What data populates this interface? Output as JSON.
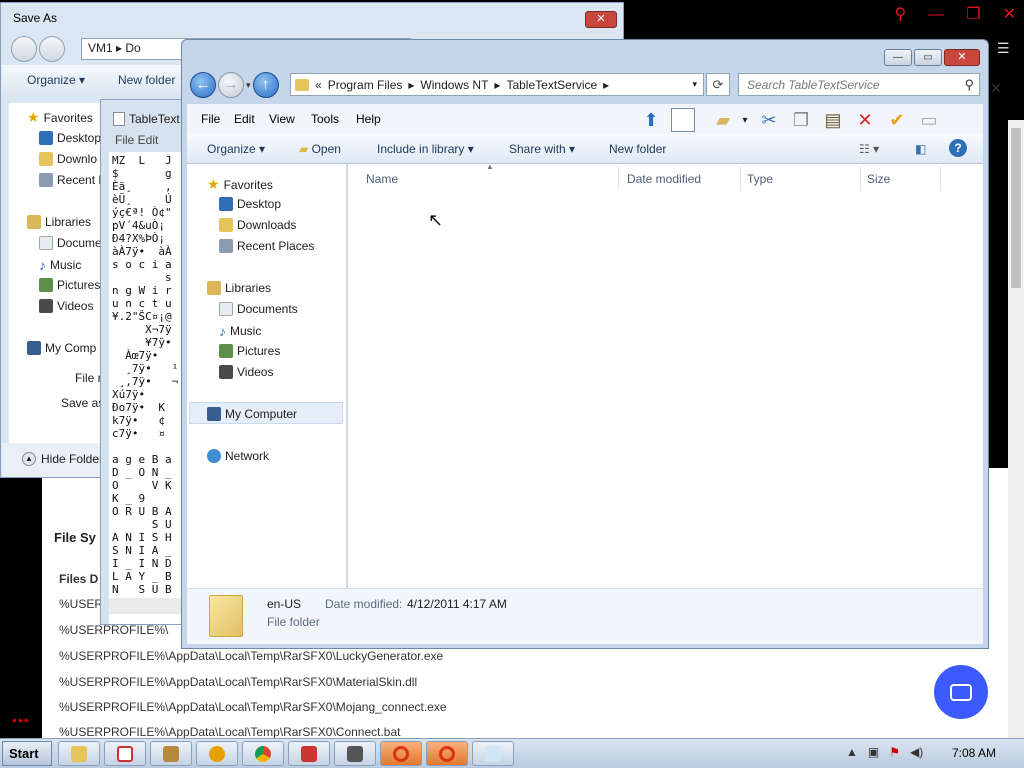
{
  "background": {
    "page_lines": [
      "%USERPROFILE%\\AppData\\Local\\Temp\\RarSFX0\\LuckyGenerator.exe",
      "%USERPROFILE%\\AppData\\Local\\Temp\\RarSFX0\\MaterialSkin.dll",
      "%USERPROFILE%\\AppData\\Local\\Temp\\RarSFX0\\Mojang_connect.exe",
      "%USERPROFILE%\\AppData\\Local\\Temp\\RarSFX0\\Connect.bat"
    ],
    "truncated_line_1": "%USERPROFILE%\\Ap",
    "truncated_line_2": "%USERPROFILE%\\",
    "section_title": "File Sy",
    "sub_title": "Files D",
    "chat_color": "#3d5afe"
  },
  "save_as": {
    "title": "Save As",
    "close": "✕",
    "address": "VM1  ▸  Do",
    "organize": "Organize ▾",
    "new_folder": "New folder",
    "nav": {
      "favorites": "Favorites",
      "desktop": "Desktop",
      "downloads": "Downlo",
      "recent": "Recent P",
      "libraries": "Libraries",
      "documents": "Docume",
      "music": "Music",
      "pictures": "Pictures",
      "videos": "Videos",
      "computer": "My Comp"
    },
    "file_name": "File n",
    "save_as_type": "Save as",
    "hide_folders": "Hide Folders"
  },
  "notepad": {
    "title": "TableText",
    "menu": "File   Edit",
    "content": "MZ  L   J\n$       g\nÈä¸     ,\nèÜ¸     Ú\nýç€ª! Ò¢\"\npV´4&uÒ¡\nÐ4?X%ÞÒ¡\nàÀ7ÿ•  àÀ\ns o c i a\n        s\nn g W i r\nu n c t u\n¥.2\"ŠC¤¡@\n     X¬7ÿ\n     ¥7ÿ•\n  Àœ7ÿ•\n  ¸7ÿ•   ¹\n ¸,7ÿ•   ¬\nXú7ÿ•\nÐo7ÿ•  K\nk7ÿ•   ¢\nc7ÿ•   ¤\n\na g e B a\nD _ O N _\nO     V K\nK _ 9\nO R U B A\n      S U\nA N I S H\nS N I A _\nI _ I N D\nL A Y _ B\nN   S U B"
  },
  "explorer": {
    "breadcrumb": [
      "«",
      "Program Files",
      "Windows NT",
      "TableTextService"
    ],
    "search_placeholder": "Search TableTextService",
    "menu": {
      "file": "File",
      "edit": "Edit",
      "view": "View",
      "tools": "Tools",
      "help": "Help"
    },
    "cmd": {
      "organize": "Organize",
      "open": "Open",
      "include": "Include in library",
      "share": "Share with",
      "new_folder": "New folder"
    },
    "nav": {
      "favorites": "Favorites",
      "desktop": "Desktop",
      "downloads": "Downloads",
      "recent": "Recent Places",
      "libraries": "Libraries",
      "documents": "Documents",
      "music": "Music",
      "pictures": "Pictures",
      "videos": "Videos",
      "computer": "My Computer",
      "network": "Network"
    },
    "columns": {
      "name": "Name",
      "date": "Date modified",
      "type": "Type",
      "size": "Size"
    },
    "details": {
      "name": "en-US",
      "date_label": "Date modified:",
      "date_value": "4/12/2011 4:17 AM",
      "kind": "File folder"
    }
  },
  "taskbar": {
    "start": "Start",
    "clock": "7:08 AM"
  }
}
